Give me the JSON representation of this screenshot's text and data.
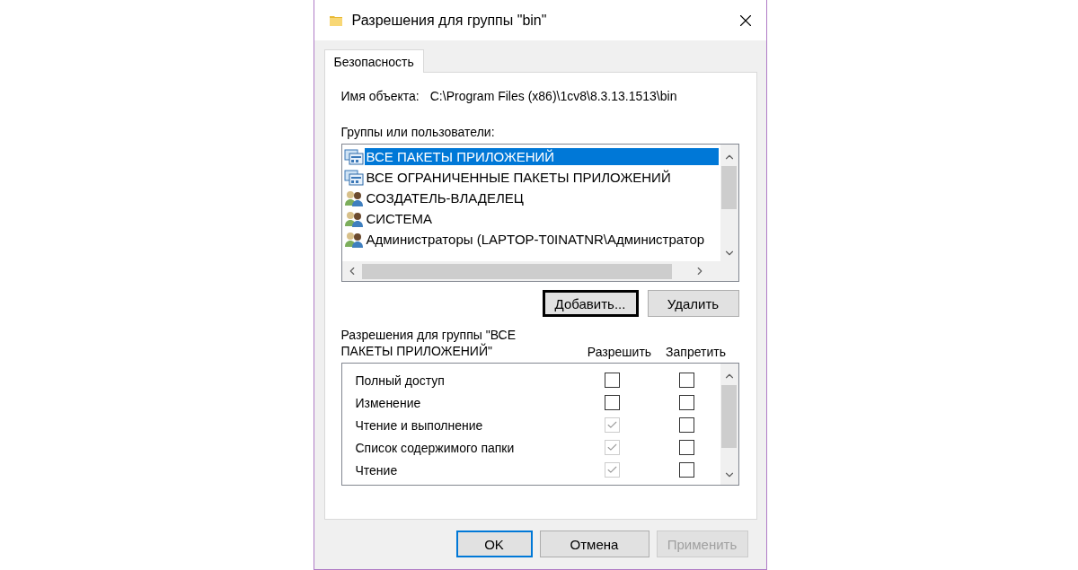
{
  "window": {
    "title": "Разрешения для группы \"bin\""
  },
  "tabs": [
    {
      "label": "Безопасность",
      "selected": true
    }
  ],
  "object_name": {
    "label": "Имя объекта:",
    "value": "C:\\Program Files (x86)\\1cv8\\8.3.13.1513\\bin"
  },
  "groups": {
    "label": "Группы или пользователи:",
    "items": [
      {
        "kind": "package",
        "name": "ВСЕ ПАКЕТЫ ПРИЛОЖЕНИЙ",
        "selected": true
      },
      {
        "kind": "package",
        "name": "ВСЕ ОГРАНИЧЕННЫЕ ПАКЕТЫ ПРИЛОЖЕНИЙ",
        "selected": false
      },
      {
        "kind": "users",
        "name": "СОЗДАТЕЛЬ-ВЛАДЕЛЕЦ",
        "selected": false
      },
      {
        "kind": "users",
        "name": "СИСТЕМА",
        "selected": false
      },
      {
        "kind": "users",
        "name": "Администраторы (LAPTOP-T0INATNR\\Администратор",
        "selected": false
      }
    ]
  },
  "group_buttons": [
    {
      "label": "Добавить...",
      "focused": true
    },
    {
      "label": "Удалить",
      "focused": false
    }
  ],
  "permissions": {
    "label": "Разрешения для группы \"ВСЕ ПАКЕТЫ ПРИЛОЖЕНИЙ\"",
    "columns": [
      "Разрешить",
      "Запретить"
    ],
    "rows": [
      {
        "name": "Полный доступ",
        "allow": {
          "checked": false,
          "disabled": false
        },
        "deny": {
          "checked": false,
          "disabled": false
        }
      },
      {
        "name": "Изменение",
        "allow": {
          "checked": false,
          "disabled": false
        },
        "deny": {
          "checked": false,
          "disabled": false
        }
      },
      {
        "name": "Чтение и выполнение",
        "allow": {
          "checked": true,
          "disabled": true
        },
        "deny": {
          "checked": false,
          "disabled": false
        }
      },
      {
        "name": "Список содержимого папки",
        "allow": {
          "checked": true,
          "disabled": true
        },
        "deny": {
          "checked": false,
          "disabled": false
        }
      },
      {
        "name": "Чтение",
        "allow": {
          "checked": true,
          "disabled": true
        },
        "deny": {
          "checked": false,
          "disabled": false
        }
      }
    ]
  },
  "buttons": [
    {
      "label": "OK",
      "kind": "default",
      "disabled": false
    },
    {
      "label": "Отмена",
      "kind": "normal",
      "disabled": false
    },
    {
      "label": "Применить",
      "kind": "normal",
      "disabled": true
    }
  ]
}
